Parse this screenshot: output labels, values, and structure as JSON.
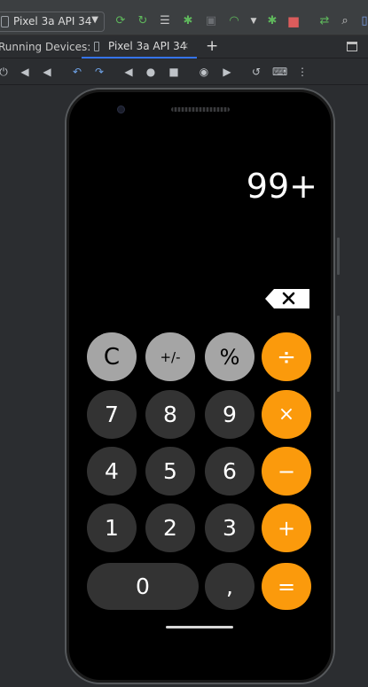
{
  "toolbar": {
    "device_selector": "Pixel 3a API 34",
    "icons": [
      "apply-changes-icon",
      "apply-code-changes-icon",
      "logcat-icon",
      "debug-icon",
      "attach-debugger-icon",
      "profiler-icon",
      "dropdown-icon",
      "stop-debug-icon",
      "stop-icon",
      "sync-icon",
      "search-icon",
      "avd-manager-icon"
    ]
  },
  "tabs": {
    "label": "Running Devices:",
    "active_tab": "Pixel 3a API 34",
    "close": "×",
    "add": "+"
  },
  "emulator_toolbar": {
    "icons": [
      "power-icon",
      "volume-up-icon",
      "volume-down-icon",
      "rotate-left-icon",
      "rotate-right-icon",
      "back-icon",
      "home-icon",
      "overview-icon",
      "screenshot-icon",
      "screen-record-icon",
      "snapshot-icon",
      "keyboard-icon",
      "more-icon"
    ]
  },
  "calculator": {
    "display": "99+",
    "keys": {
      "clear": "C",
      "sign": "+/-",
      "percent": "%",
      "divide": "÷",
      "seven": "7",
      "eight": "8",
      "nine": "9",
      "multiply": "×",
      "four": "4",
      "five": "5",
      "six": "6",
      "minus": "−",
      "one": "1",
      "two": "2",
      "three": "3",
      "plus": "+",
      "zero": "0",
      "comma": ",",
      "equals": "="
    },
    "colors": {
      "function_key": "#a5a5a5",
      "digit_key": "#333333",
      "operator_key": "#fb9a0c",
      "background": "#000000"
    }
  }
}
